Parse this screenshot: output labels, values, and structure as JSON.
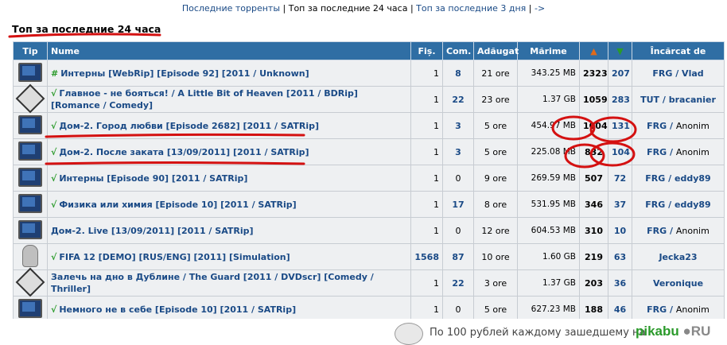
{
  "topnav": {
    "link_latest": "Последние торренты",
    "sep1": " | ",
    "current": "Топ за последние 24 часа",
    "sep2": " | ",
    "link_3days": "Топ за последние 3 дня",
    "sep3": " | ",
    "link_more": "->"
  },
  "heading": "Топ за последние 24 часа",
  "columns": {
    "tip": "Tip",
    "name": "Nume",
    "fis": "Fiș.",
    "com": "Com.",
    "added": "Adăugat",
    "size": "Mărime",
    "seed_icon": "arrow-up-icon",
    "leech_icon": "arrow-down-icon",
    "uploader": "Încărcat de"
  },
  "rows": [
    {
      "icon": "tv-icon",
      "check": "#",
      "name": "Интерны [WebRip] [Episode 92] [2011 / Unknown]",
      "fis": "1",
      "com": "8",
      "added": "21 ore",
      "size": "343.25 MB",
      "seed": "2323",
      "leech": "207",
      "uploader": "FRG / Vlad",
      "uploader_anon": false
    },
    {
      "icon": "dvd-icon",
      "check": "√",
      "name": "Главное - не бояться! / A Little Bit of Heaven [2011 / BDRip] [Romance / Comedy]",
      "fis": "1",
      "com": "22",
      "added": "23 ore",
      "size": "1.37 GB",
      "seed": "1059",
      "leech": "283",
      "uploader": "TUT / bracanier",
      "uploader_anon": false
    },
    {
      "icon": "tv-icon",
      "check": "√",
      "name": "Дом-2. Город любви [Episode 2682] [2011 / SATRip]",
      "fis": "1",
      "com": "3",
      "added": "5 ore",
      "size": "454.97 MB",
      "seed": "1004",
      "leech": "131",
      "uploader": "FRG / Anonim",
      "uploader_anon": true
    },
    {
      "icon": "tv-icon",
      "check": "√",
      "name": "Дом-2. После заката [13/09/2011] [2011 / SATRip]",
      "fis": "1",
      "com": "3",
      "added": "5 ore",
      "size": "225.08 MB",
      "seed": "832",
      "leech": "104",
      "uploader": "FRG / Anonim",
      "uploader_anon": true
    },
    {
      "icon": "tv-icon",
      "check": "√",
      "name": "Интерны [Episode 90] [2011 / SATRip]",
      "fis": "1",
      "com": "0",
      "added": "9 ore",
      "size": "269.59 MB",
      "seed": "507",
      "leech": "72",
      "uploader": "FRG / eddy89",
      "uploader_anon": false
    },
    {
      "icon": "tv-icon",
      "check": "√",
      "name": "Физика или химия [Episode 10] [2011 / SATRip]",
      "fis": "1",
      "com": "17",
      "added": "8 ore",
      "size": "531.95 MB",
      "seed": "346",
      "leech": "37",
      "uploader": "FRG / eddy89",
      "uploader_anon": false
    },
    {
      "icon": "tv-icon",
      "check": "",
      "name": "Дом-2. Live [13/09/2011] [2011 / SATRip]",
      "fis": "1",
      "com": "0",
      "added": "12 ore",
      "size": "604.53 MB",
      "seed": "310",
      "leech": "10",
      "uploader": "FRG / Anonim",
      "uploader_anon": true
    },
    {
      "icon": "gamepad-icon",
      "check": "√",
      "name": "FIFA 12 [DEMO] [RUS/ENG] [2011] [Simulation]",
      "fis": "1568",
      "com": "87",
      "added": "10 ore",
      "size": "1.60 GB",
      "seed": "219",
      "leech": "63",
      "uploader": "Jecka23",
      "uploader_anon": false
    },
    {
      "icon": "dvd-icon",
      "check": "",
      "name": "Залечь на дно в Дублине / The Guard [2011 / DVDscr] [Comedy / Thriller]",
      "fis": "1",
      "com": "22",
      "added": "3 ore",
      "size": "1.37 GB",
      "seed": "203",
      "leech": "36",
      "uploader": "Veronique",
      "uploader_anon": false
    },
    {
      "icon": "tv-icon",
      "check": "√",
      "name": "Немного не в себе [Episode 10] [2011 / SATRip]",
      "fis": "1",
      "com": "0",
      "added": "5 ore",
      "size": "627.23 MB",
      "seed": "188",
      "leech": "46",
      "uploader": "FRG / Anonim",
      "uploader_anon": true
    }
  ],
  "footer": {
    "text": "По 100 рублей каждому зашедшему на",
    "logo": "pikabu",
    "logo_tld": "RU"
  },
  "colors": {
    "header_bg": "#2f6ea4",
    "row_bg": "#eef0f2",
    "link": "#1a4a86",
    "annotation_red": "#d41111",
    "check_green": "#2a9a2a"
  }
}
